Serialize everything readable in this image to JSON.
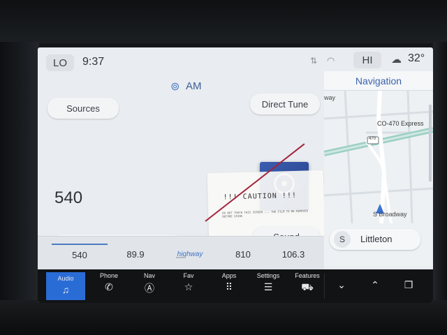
{
  "status": {
    "left_zone": "LO",
    "time": "9:37",
    "right_zone": "HI",
    "temperature": "32°",
    "icons": [
      "signal-icon",
      "wifi-icon",
      "weather-cloud-icon"
    ]
  },
  "audio": {
    "band": "AM",
    "sources_label": "Sources",
    "direct_tune_label": "Direct Tune",
    "sound_label": "Sound",
    "frequency": "540",
    "controls": [
      "⏮",
      "—",
      "+",
      "⏭"
    ],
    "presets": [
      "540",
      "89.9",
      "highway",
      "810",
      "106.3"
    ],
    "sticker_title": "!!! CAUTION !!!",
    "sticker_body": "DO NOT TOUCH THIS SCREEN ... THE FILM TO BE REMOVED BEFORE USING"
  },
  "navigation": {
    "title": "Navigation",
    "road_label": "CO-470 Express",
    "shield": "470",
    "street_label": "S Broadway",
    "partial_label": "way",
    "direction": "S",
    "city": "Littleton"
  },
  "dock": {
    "audio": "Audio",
    "phone": "Phone",
    "nav": "Nav",
    "fav": "Fav",
    "apps": "Apps",
    "settings": "Settings",
    "features": "Features"
  },
  "colors": {
    "accent": "#2a6cd6",
    "screen_bg": "#e9ecf0",
    "dock_bg": "#111315",
    "nav_title": "#3b63ad"
  }
}
